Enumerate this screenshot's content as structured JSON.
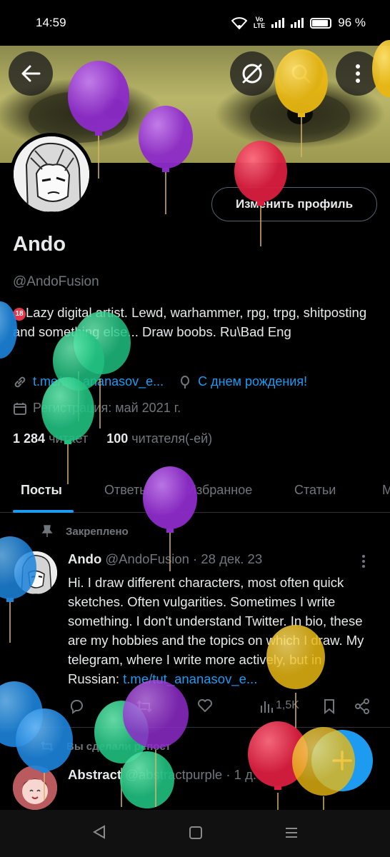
{
  "status_bar": {
    "time": "14:59",
    "network": "Vo LTE",
    "battery_text": "96 %"
  },
  "profile": {
    "edit_button": "Изменить профиль",
    "display_name": "Ando",
    "handle": "@AndoFusion",
    "bio_badge": "18",
    "bio": "Lazy digital artist. Lewd, warhammer, rpg, trpg, shitposting and something else... Draw boobs.  Ru\\Bad Eng",
    "link": "t.me/tut_ananasov_e...",
    "birthday": "С днем рождения!",
    "joined": "Регистрация: май 2021 г.",
    "following_count": "1 284",
    "following_label": "читает",
    "followers_count": "100",
    "followers_label": "читателя(-ей)"
  },
  "tabs": [
    "Посты",
    "Ответы",
    "Избранное",
    "Статьи",
    "М"
  ],
  "pinned": {
    "label": "Закреплено",
    "author": "Ando",
    "handle_date": "@AndoFusion · 28 дек. 23",
    "text": "Hi. I draw different characters, most often quick sketches. Often vulgarities. Sometimes I write something. I don't understand Twitter. In bio, these are my hobbies and the topics on which I draw. My telegram, where I write more actively, but in Russian: ",
    "link": "t.me/tut_ananasov_e...",
    "views": "1,5K"
  },
  "repost": {
    "label": "Вы сделали репост",
    "author": "Abstract",
    "handle_date": "@abstractpurple · 1 д."
  },
  "colors": {
    "accent": "#1d9bf0",
    "background": "#000000",
    "muted": "#71767b"
  },
  "icons": [
    "back-arrow-icon",
    "hide-icon",
    "search-icon",
    "more-vertical-icon",
    "link-icon",
    "balloon-icon",
    "calendar-icon",
    "pin-icon",
    "repost-icon",
    "reply-icon",
    "retweet-icon",
    "like-icon",
    "views-icon",
    "bookmark-icon",
    "share-icon",
    "plus-icon"
  ]
}
